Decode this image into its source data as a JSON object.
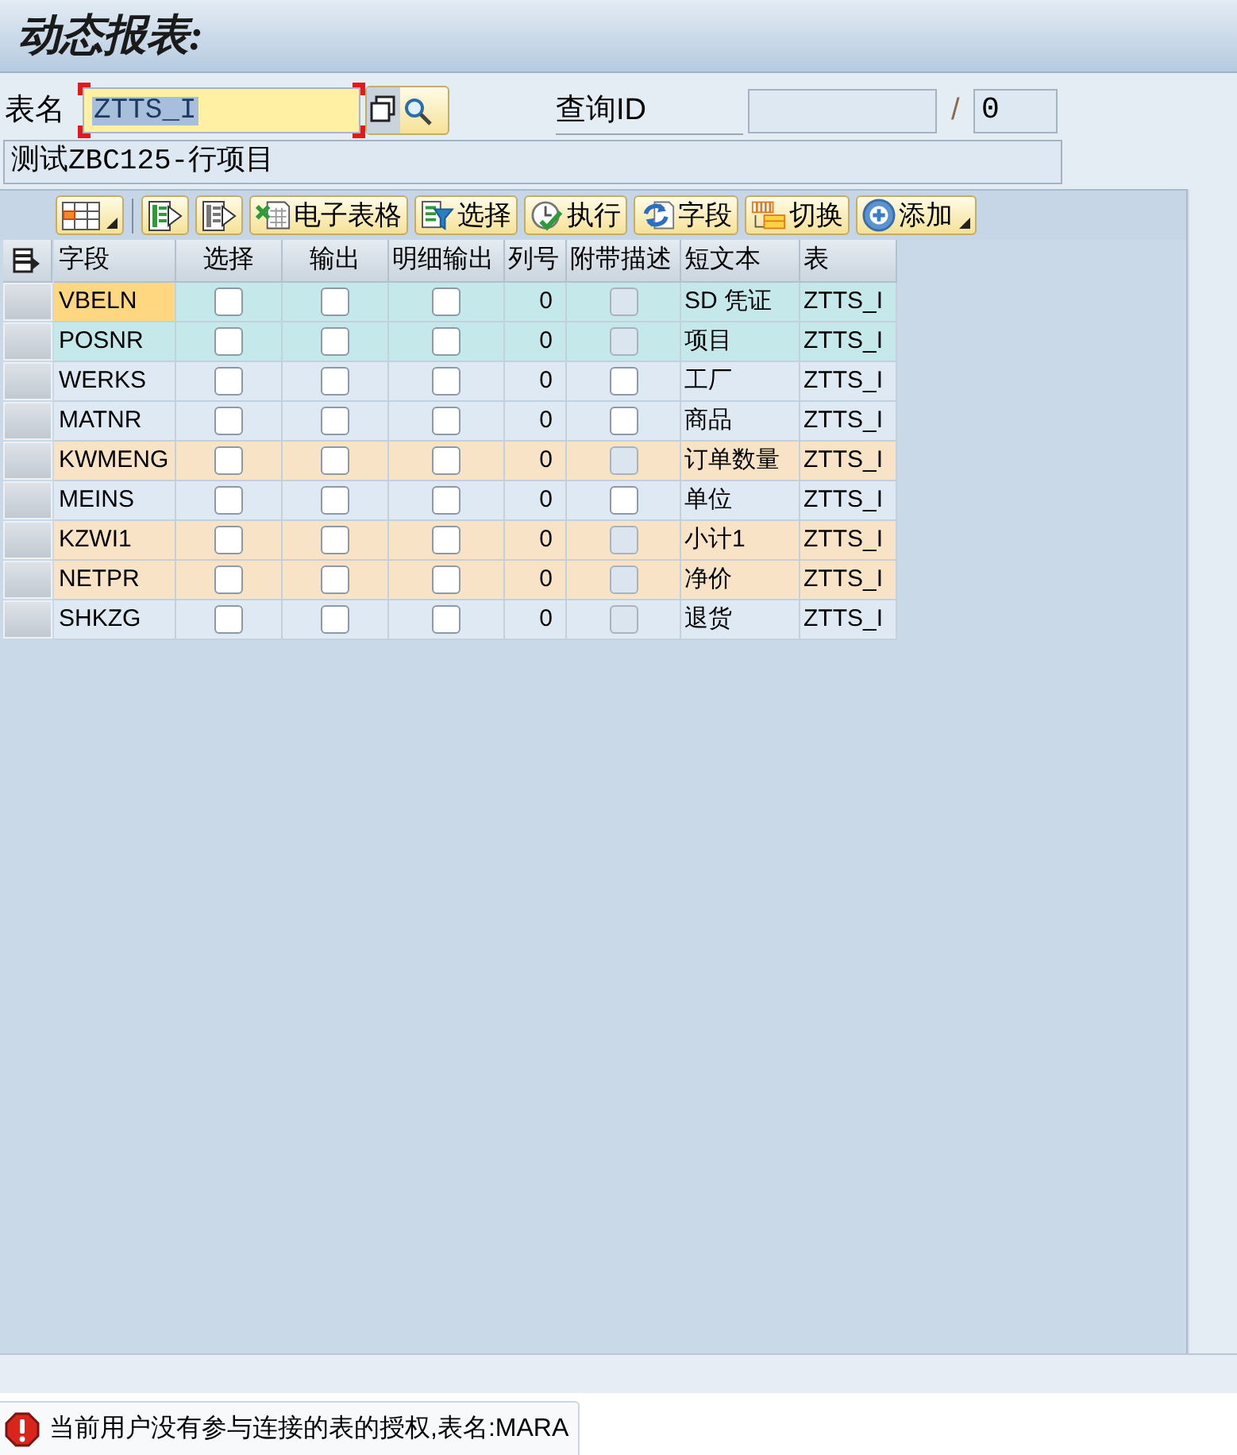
{
  "header": {
    "title": "动态报表:"
  },
  "selection": {
    "table_name": {
      "label": "表名",
      "value": "ZTTS_I",
      "focused": true
    },
    "query_id": {
      "label": "查询ID",
      "separator": "/",
      "count": "0"
    },
    "description": "测试ZBC125-行项目"
  },
  "toolbar": [
    {
      "kind": "menu"
    },
    {
      "kind": "separator"
    },
    {
      "kind": "icon"
    },
    {
      "kind": "icon"
    },
    {
      "kind": "button",
      "label": "电子表格"
    },
    {
      "kind": "button",
      "label": "选择"
    },
    {
      "kind": "button",
      "label": "执行"
    },
    {
      "kind": "button",
      "label": "字段"
    },
    {
      "kind": "button",
      "label": "切换"
    },
    {
      "kind": "menu",
      "label": "添加"
    }
  ],
  "table": {
    "columns": [
      "字段",
      "选择",
      "输出",
      "明细输出",
      "列号",
      "附带描述",
      "短文本",
      "表"
    ],
    "rows": [
      {
        "field": "VBELN",
        "selected": true,
        "color": "#c5e8ea",
        "select_checked": false,
        "output_checked": false,
        "detail_checked": false,
        "column_no": "0",
        "desc_checked": false,
        "desc_disabled": true,
        "short_text": "SD 凭证",
        "table": "ZTTS_I"
      },
      {
        "field": "POSNR",
        "selected": false,
        "color": "#c5e8ea",
        "select_checked": false,
        "output_checked": false,
        "detail_checked": false,
        "column_no": "0",
        "desc_checked": false,
        "desc_disabled": true,
        "short_text": "项目",
        "table": "ZTTS_I"
      },
      {
        "field": "WERKS",
        "selected": false,
        "color": "#dee9f4",
        "select_checked": false,
        "output_checked": false,
        "detail_checked": false,
        "column_no": "0",
        "desc_checked": false,
        "desc_disabled": false,
        "short_text": "工厂",
        "table": "ZTTS_I"
      },
      {
        "field": "MATNR",
        "selected": false,
        "color": "#dee9f4",
        "select_checked": false,
        "output_checked": false,
        "detail_checked": false,
        "column_no": "0",
        "desc_checked": false,
        "desc_disabled": false,
        "short_text": "商品",
        "table": "ZTTS_I"
      },
      {
        "field": "KWMENG",
        "selected": false,
        "color": "#f9e3c7",
        "select_checked": false,
        "output_checked": false,
        "detail_checked": false,
        "column_no": "0",
        "desc_checked": false,
        "desc_disabled": true,
        "short_text": "订单数量",
        "table": "ZTTS_I"
      },
      {
        "field": "MEINS",
        "selected": false,
        "color": "#dee9f4",
        "select_checked": false,
        "output_checked": false,
        "detail_checked": false,
        "column_no": "0",
        "desc_checked": false,
        "desc_disabled": false,
        "short_text": "单位",
        "table": "ZTTS_I"
      },
      {
        "field": "KZWI1",
        "selected": false,
        "color": "#f9e3c7",
        "select_checked": false,
        "output_checked": false,
        "detail_checked": false,
        "column_no": "0",
        "desc_checked": false,
        "desc_disabled": true,
        "short_text": "小计1",
        "table": "ZTTS_I"
      },
      {
        "field": "NETPR",
        "selected": false,
        "color": "#f9e3c7",
        "select_checked": false,
        "output_checked": false,
        "detail_checked": false,
        "column_no": "0",
        "desc_checked": false,
        "desc_disabled": true,
        "short_text": "净价",
        "table": "ZTTS_I"
      },
      {
        "field": "SHKZG",
        "selected": false,
        "color": "#dee9f4",
        "select_checked": false,
        "output_checked": false,
        "detail_checked": false,
        "column_no": "0",
        "desc_checked": false,
        "desc_disabled": true,
        "short_text": "退货",
        "table": "ZTTS_I"
      }
    ]
  },
  "status_bar": {
    "kind": "error",
    "message": "当前用户没有参与连接的表的授权,表名:MARA"
  }
}
